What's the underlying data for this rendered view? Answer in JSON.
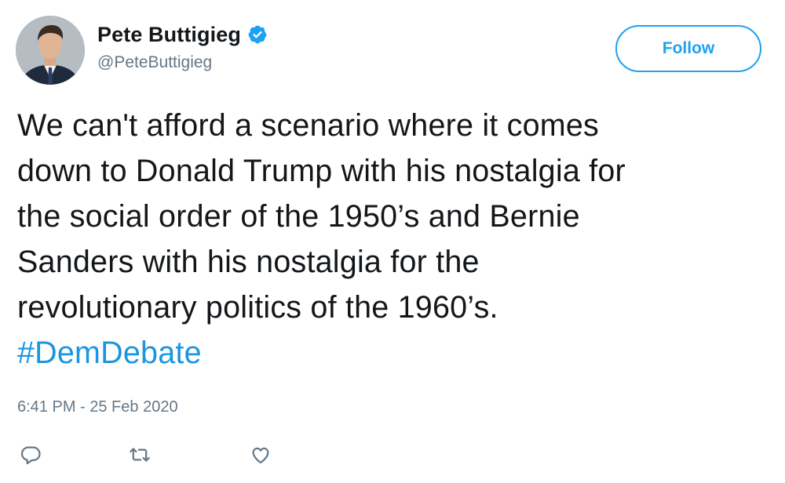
{
  "user": {
    "display_name": "Pete Buttigieg",
    "handle": "@PeteButtigieg",
    "verified": true
  },
  "follow_label": "Follow",
  "tweet": {
    "lines": [
      "We can't afford a scenario where it comes",
      "down to Donald Trump with his nostalgia for",
      "the social order of the 1950’s and Bernie",
      "Sanders with his nostalgia for the",
      "revolutionary politics of the 1960’s."
    ],
    "hashtag": "#DemDebate"
  },
  "timestamp": "6:41 PM - 25 Feb 2020",
  "actions": [
    "reply-icon",
    "retweet-icon",
    "like-icon"
  ],
  "colors": {
    "accent": "#1da1f2",
    "hashtag": "#1b95e0",
    "secondary_text": "#657786",
    "primary_text": "#14171a"
  }
}
